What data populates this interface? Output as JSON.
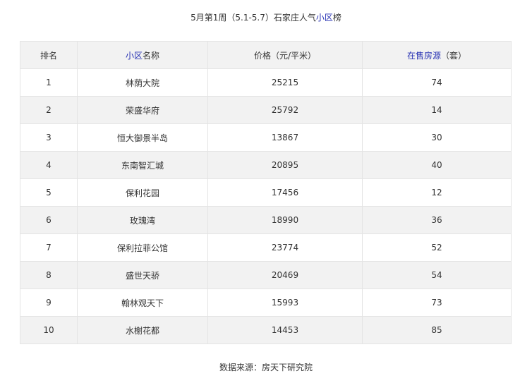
{
  "caption": {
    "prefix": "5月第1周（5.1-5.7）石家庄人气",
    "link": "小区",
    "suffix": "榜"
  },
  "table": {
    "headers": {
      "rank": "排名",
      "name_link": "小区",
      "name_suffix": "名称",
      "price": "价格（元/平米）",
      "count_link": "在售房源",
      "count_suffix": "（套）"
    },
    "rows": [
      {
        "rank": "1",
        "name": "林荫大院",
        "price": "25215",
        "count": "74"
      },
      {
        "rank": "2",
        "name": "荣盛华府",
        "price": "25792",
        "count": "14"
      },
      {
        "rank": "3",
        "name": "恒大御景半岛",
        "price": "13867",
        "count": "30"
      },
      {
        "rank": "4",
        "name": "东南智汇城",
        "price": "20895",
        "count": "40"
      },
      {
        "rank": "5",
        "name": "保利花园",
        "price": "17456",
        "count": "12"
      },
      {
        "rank": "6",
        "name": "玫瑰湾",
        "price": "18990",
        "count": "36"
      },
      {
        "rank": "7",
        "name": "保利拉菲公馆",
        "price": "23774",
        "count": "52"
      },
      {
        "rank": "8",
        "name": "盛世天骄",
        "price": "20469",
        "count": "54"
      },
      {
        "rank": "9",
        "name": "翰林观天下",
        "price": "15993",
        "count": "73"
      },
      {
        "rank": "10",
        "name": "水榭花都",
        "price": "14453",
        "count": "85"
      }
    ]
  },
  "footer": {
    "source": "数据来源：房天下研究院"
  },
  "colors": {
    "link": "#2630b3",
    "header_bg": "#f2f2f2",
    "stripe_bg": "#f2f2f2",
    "border": "#e4e4e4"
  }
}
